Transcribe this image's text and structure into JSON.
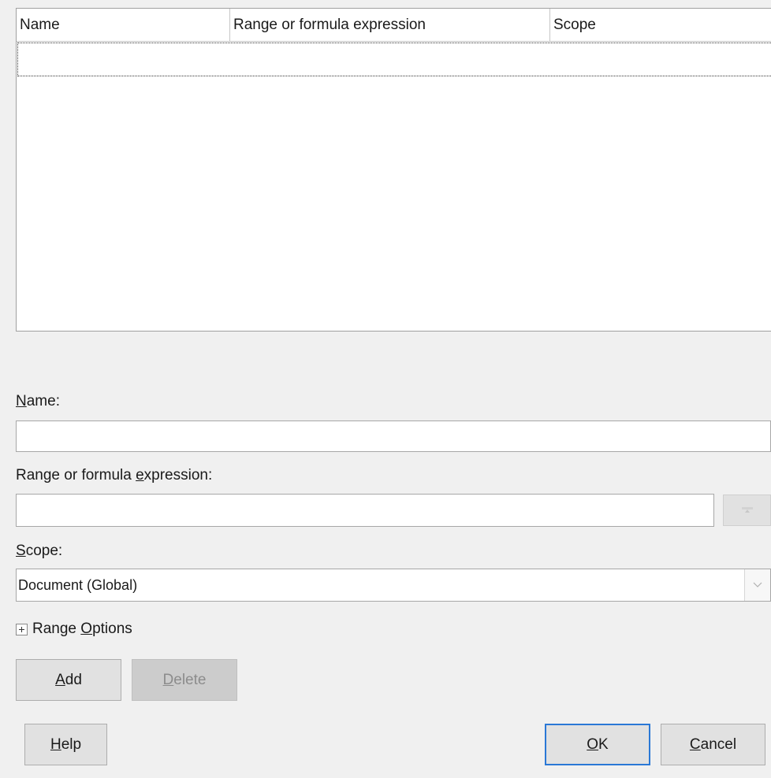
{
  "names_list": {
    "columns": [
      "Name",
      "Range or formula expression",
      "Scope"
    ],
    "rows": []
  },
  "name_field": {
    "label_mnemonic": "N",
    "label_rest": "ame:",
    "value": ""
  },
  "range_field": {
    "label_pre": "Range or formula ",
    "label_mnemonic": "e",
    "label_post": "xpression:",
    "value": ""
  },
  "scope_field": {
    "label_mnemonic": "S",
    "label_rest": "cope:",
    "selected": "Document (Global)"
  },
  "range_options": {
    "label_pre": "Range ",
    "label_mnemonic": "O",
    "label_post": "ptions"
  },
  "buttons": {
    "add": {
      "mnemonic": "A",
      "rest": "dd"
    },
    "delete": {
      "mnemonic": "D",
      "rest": "elete",
      "enabled": false
    },
    "help": {
      "mnemonic": "H",
      "rest": "elp"
    },
    "ok": {
      "mnemonic": "O",
      "rest": "K"
    },
    "cancel": {
      "mnemonic": "C",
      "rest": "ancel"
    }
  },
  "icons": {
    "shrink": "shrink-icon",
    "dropdown": "chevron-down-icon",
    "expand": "plus-box-icon"
  }
}
